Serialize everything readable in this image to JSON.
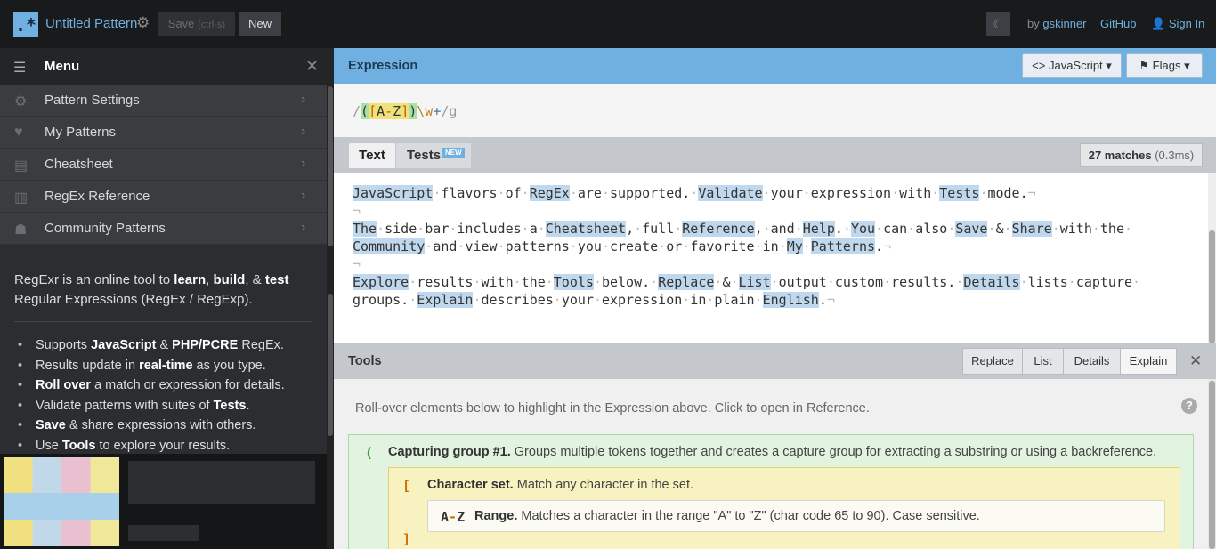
{
  "header": {
    "logo": ".*",
    "title": "Untitled Pattern",
    "save_label": "Save",
    "save_shortcut": "(ctrl-s)",
    "new_label": "New",
    "by_label": "by",
    "author": "gskinner",
    "github_label": "GitHub",
    "signin_label": "Sign In"
  },
  "sidebar": {
    "menu_label": "Menu",
    "items": [
      {
        "label": "Pattern Settings",
        "icon": "gear-icon"
      },
      {
        "label": "My Patterns",
        "icon": "heart-icon"
      },
      {
        "label": "Cheatsheet",
        "icon": "document-icon"
      },
      {
        "label": "RegEx Reference",
        "icon": "book-icon"
      },
      {
        "label": "Community Patterns",
        "icon": "users-icon"
      }
    ],
    "intro": {
      "p1": "RegExr is an online tool to ",
      "learn": "learn",
      "comma1": ", ",
      "build": "build",
      "amp1": ", & ",
      "test": "test",
      "p2": " Regular Expressions (RegEx / RegExp)."
    },
    "bullets": {
      "b1a": "Supports ",
      "b1b": "JavaScript",
      "b1c": " & ",
      "b1d": "PHP/PCRE",
      "b1e": " RegEx.",
      "b2a": "Results update in ",
      "b2b": "real-time",
      "b2c": " as you type.",
      "b3a": "Roll over",
      "b3b": " a match or expression for details.",
      "b4a": "Validate patterns with suites of ",
      "b4b": "Tests",
      "b4c": ".",
      "b5a": "Save",
      "b5b": " & share expressions with others.",
      "b6a": "Use ",
      "b6b": "Tools",
      "b6c": " to explore your results."
    }
  },
  "expression": {
    "label": "Expression",
    "language_label": "JavaScript",
    "flags_label": "Flags",
    "open_slash": "/",
    "group_open": "(",
    "set_open": "[",
    "range_a": "A",
    "range_dash": "-",
    "range_z": "Z",
    "set_close": "]",
    "group_close": ")",
    "escape": "\\w",
    "quantifier": "+",
    "close_slash": "/",
    "flags": "g"
  },
  "text_panel": {
    "tab_text": "Text",
    "tab_tests": "Tests",
    "new_badge": "NEW",
    "match_count": "27 matches",
    "match_time": "(0.3ms)"
  },
  "tools": {
    "label": "Tools",
    "tabs": [
      "Replace",
      "List",
      "Details",
      "Explain"
    ],
    "rollover_hint": "Roll-over elements below to highlight in the Expression above. Click to open in Reference.",
    "group": {
      "token": "(",
      "title": "Capturing group #1.",
      "desc": " Groups multiple tokens together and creates a capture group for extracting a substring or using a backreference."
    },
    "set": {
      "token": "[",
      "close_token": "]",
      "title": "Character set.",
      "desc": " Match any character in the set."
    },
    "range": {
      "token_a": "A",
      "token_dash": "-",
      "token_z": "Z",
      "title": "Range.",
      "desc": " Matches a character in the range \"A\" to \"Z\" (char code 65 to 90). Case sensitive."
    }
  },
  "colors": {
    "accent": "#70b0e0",
    "match_highlight": "#c0d8ee",
    "group_green": "#a8e0a8",
    "set_yellow": "#f0e27a"
  }
}
